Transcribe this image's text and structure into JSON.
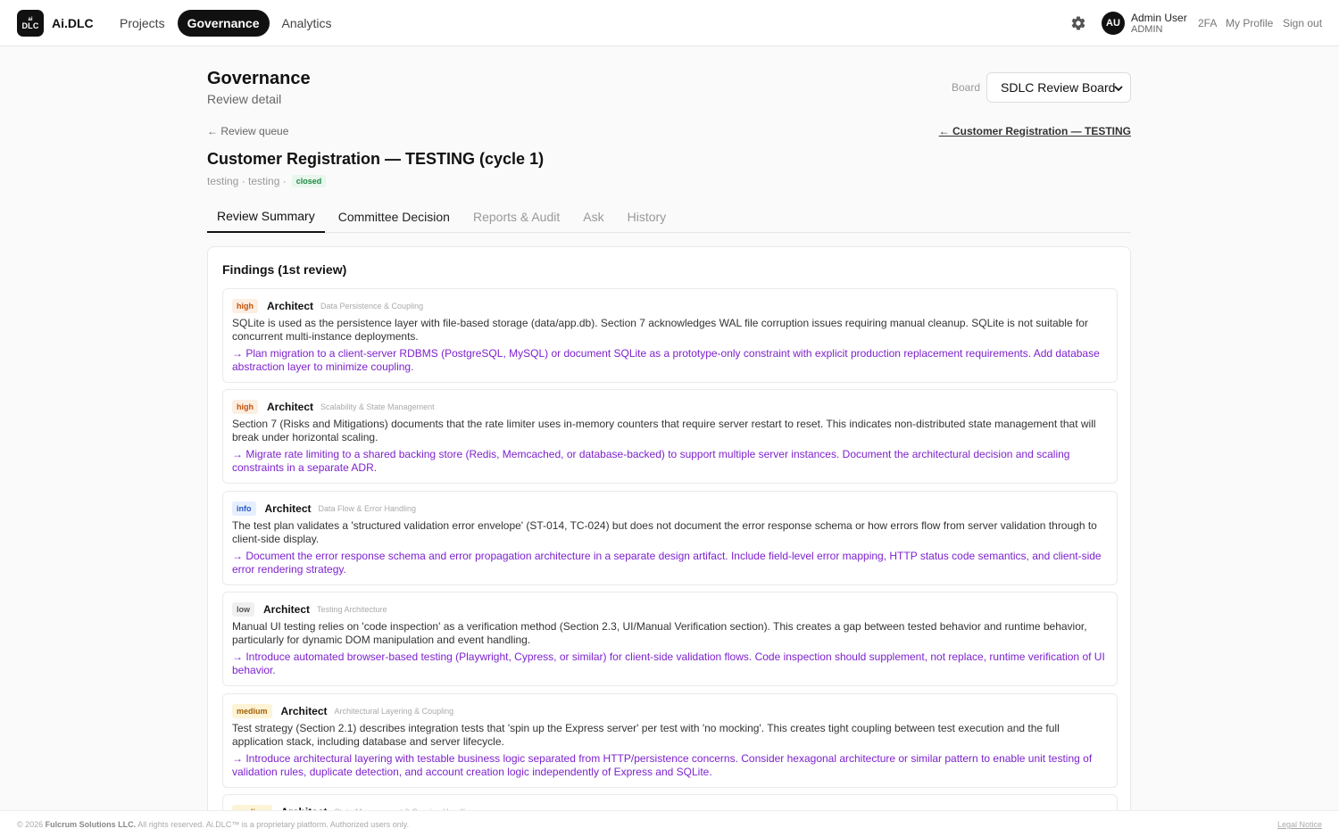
{
  "header": {
    "logo_line1": "ai",
    "logo_line2": "DLC",
    "brand": "Ai.DLC",
    "nav": [
      "Projects",
      "Governance",
      "Analytics"
    ],
    "user_initials": "AU",
    "user_name": "Admin User",
    "user_role": "ADMIN",
    "link_2fa": "2FA",
    "link_profile": "My Profile",
    "link_signout": "Sign out"
  },
  "page": {
    "title": "Governance",
    "subtitle": "Review detail",
    "board_label": "Board",
    "board_value": "SDLC Review Board",
    "back_queue": "← Review queue",
    "back_project": "← Customer Registration — TESTING",
    "review_title": "Customer Registration — TESTING (cycle 1)",
    "meta": "testing · testing ·",
    "status": "closed"
  },
  "tabs": [
    "Review Summary",
    "Committee Decision",
    "Reports & Audit",
    "Ask",
    "History"
  ],
  "findings": {
    "title": "Findings (1st review)",
    "items": [
      {
        "severity": "high",
        "role": "Architect",
        "category": "Data Persistence & Coupling",
        "text": "SQLite is used as the persistence layer with file-based storage (data/app.db). Section 7 acknowledges WAL file corruption issues requiring manual cleanup. SQLite is not suitable for concurrent multi-instance deployments.",
        "rec": "→ Plan migration to a client-server RDBMS (PostgreSQL, MySQL) or document SQLite as a prototype-only constraint with explicit production replacement requirements. Add database abstraction layer to minimize coupling."
      },
      {
        "severity": "high",
        "role": "Architect",
        "category": "Scalability & State Management",
        "text": "Section 7 (Risks and Mitigations) documents that the rate limiter uses in-memory counters that require server restart to reset. This indicates non-distributed state management that will break under horizontal scaling.",
        "rec": "→ Migrate rate limiting to a shared backing store (Redis, Memcached, or database-backed) to support multiple server instances. Document the architectural decision and scaling constraints in a separate ADR."
      },
      {
        "severity": "info",
        "role": "Architect",
        "category": "Data Flow & Error Handling",
        "text": "The test plan validates a 'structured validation error envelope' (ST-014, TC-024) but does not document the error response schema or how errors flow from server validation through to client-side display.",
        "rec": "→ Document the error response schema and error propagation architecture in a separate design artifact. Include field-level error mapping, HTTP status code semantics, and client-side error rendering strategy."
      },
      {
        "severity": "low",
        "role": "Architect",
        "category": "Testing Architecture",
        "text": "Manual UI testing relies on 'code inspection' as a verification method (Section 2.3, UI/Manual Verification section). This creates a gap between tested behavior and runtime behavior, particularly for dynamic DOM manipulation and event handling.",
        "rec": "→ Introduce automated browser-based testing (Playwright, Cypress, or similar) for client-side validation flows. Code inspection should supplement, not replace, runtime verification of UI behavior."
      },
      {
        "severity": "medium",
        "role": "Architect",
        "category": "Architectural Layering & Coupling",
        "text": "Test strategy (Section 2.1) describes integration tests that 'spin up the Express server' per test with 'no mocking'. This creates tight coupling between test execution and the full application stack, including database and server lifecycle.",
        "rec": "→ Introduce architectural layering with testable business logic separated from HTTP/persistence concerns. Consider hexagonal architecture or similar pattern to enable unit testing of validation rules, duplicate detection, and account creation logic independently of Express and SQLite."
      },
      {
        "severity": "medium",
        "role": "Architect",
        "category": "State Management & Session Handling",
        "text": "",
        "rec": ""
      }
    ]
  },
  "footer": {
    "year_prefix": "© 2026",
    "company": "Fulcrum Solutions LLC.",
    "rest": "All rights reserved. Ai.DLC™ is a proprietary platform. Authorized users only.",
    "legal": "Legal Notice"
  }
}
